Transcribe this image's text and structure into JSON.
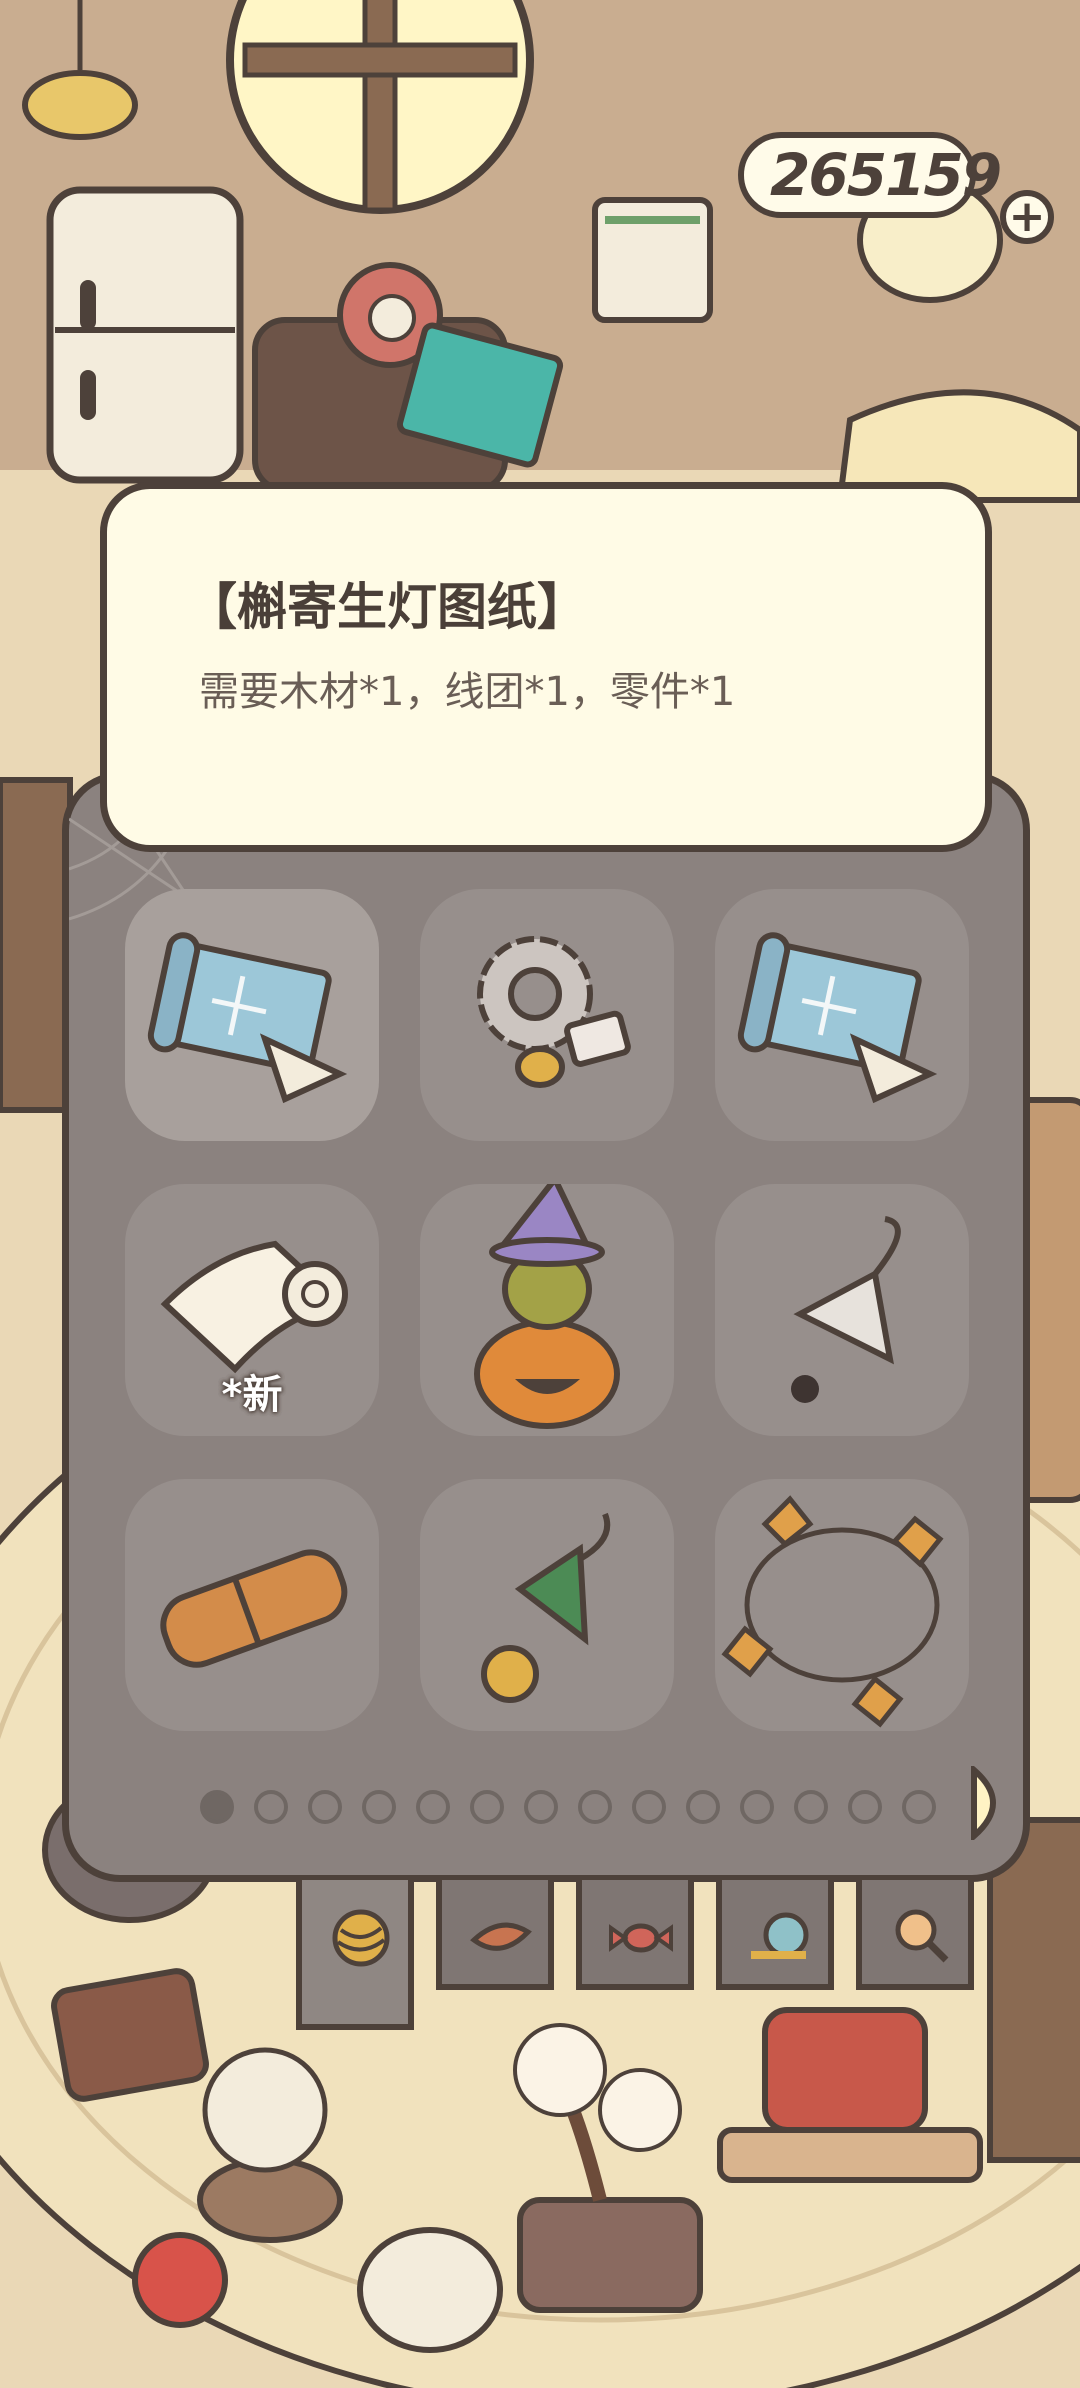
{
  "header": {
    "currency_value": "265159"
  },
  "tooltip": {
    "title": "【槲寄生灯图纸】",
    "description": "需要木材*1，线团*1，零件*1"
  },
  "inventory": {
    "items": [
      {
        "icon": "blueprint-scroll-icon"
      },
      {
        "icon": "gear-parts-icon"
      },
      {
        "icon": "blueprint-scroll-icon"
      },
      {
        "icon": "paper-roll-icon",
        "badge": "*新"
      },
      {
        "icon": "pumpkin-stack-icon"
      },
      {
        "icon": "spiderweb-charm-icon"
      },
      {
        "icon": "wooden-bundle-icon"
      },
      {
        "icon": "pine-bell-icon"
      },
      {
        "icon": "autumn-leaf-garland-icon"
      }
    ],
    "page_count": 14,
    "current_page": 1
  },
  "tabs": [
    {
      "icon": "yarn-ball-icon",
      "active": true
    },
    {
      "icon": "leaf-icon",
      "active": false
    },
    {
      "icon": "candy-icon",
      "active": false
    },
    {
      "icon": "snail-icon",
      "active": false
    },
    {
      "icon": "magnifier-icon",
      "active": false
    }
  ],
  "colors": {
    "outline": "#4d413a",
    "panel": "#8b827f",
    "tooltip_bg": "#fffbe6"
  }
}
